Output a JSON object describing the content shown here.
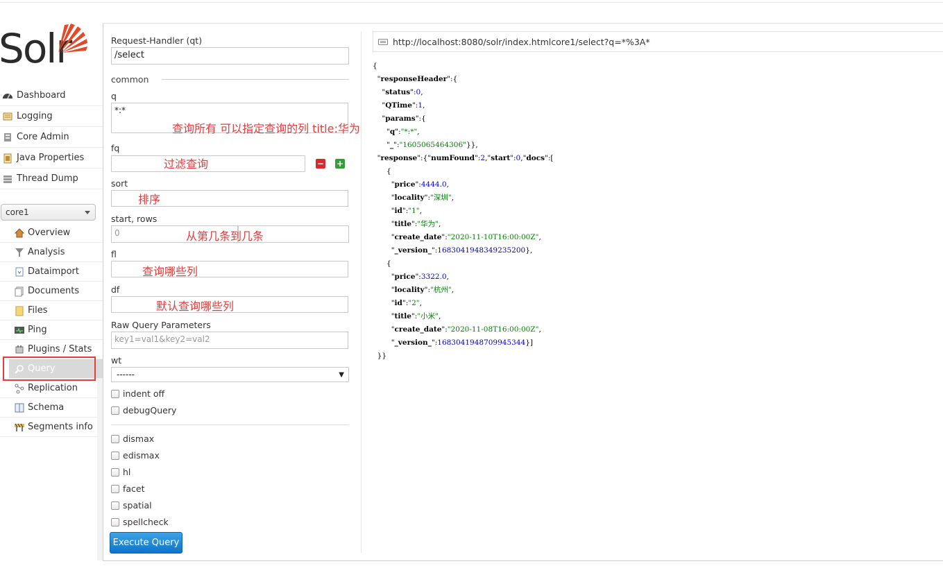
{
  "logo": {
    "text": "Solr"
  },
  "nav": {
    "items": [
      {
        "label": "Dashboard",
        "icon": "dashboard-icon"
      },
      {
        "label": "Logging",
        "icon": "logging-icon"
      },
      {
        "label": "Core Admin",
        "icon": "core-admin-icon"
      },
      {
        "label": "Java Properties",
        "icon": "java-properties-icon"
      },
      {
        "label": "Thread Dump",
        "icon": "thread-dump-icon"
      }
    ]
  },
  "core_selector": {
    "value": "core1"
  },
  "core_nav": {
    "items": [
      {
        "label": "Overview"
      },
      {
        "label": "Analysis"
      },
      {
        "label": "Dataimport"
      },
      {
        "label": "Documents"
      },
      {
        "label": "Files"
      },
      {
        "label": "Ping"
      },
      {
        "label": "Plugins / Stats"
      },
      {
        "label": "Query"
      },
      {
        "label": "Replication"
      },
      {
        "label": "Schema"
      },
      {
        "label": "Segments info"
      }
    ]
  },
  "form": {
    "request_handler_label": "Request-Handler (qt)",
    "request_handler_value": "/select",
    "common_legend": "common",
    "q_label": "q",
    "q_value": "*:*",
    "q_annotation": "查询所有 可以指定查询的列  title:华为",
    "fq_label": "fq",
    "fq_annotation": "过滤查询",
    "sort_label": "sort",
    "sort_annotation": "排序",
    "start_rows_label": "start, rows",
    "start_placeholder": "0",
    "start_rows_annotation": "从第几条到几条",
    "fl_label": "fl",
    "fl_annotation": "查询哪些列",
    "df_label": "df",
    "df_annotation": "默认查询哪些列",
    "raw_label": "Raw Query Parameters",
    "raw_placeholder": "key1=val1&key2=val2",
    "wt_label": "wt",
    "wt_value": "------",
    "indent_label": "indent off",
    "debug_label": "debugQuery",
    "options": [
      "dismax",
      "edismax",
      "hl",
      "facet",
      "spatial",
      "spellcheck"
    ],
    "execute_label": "Execute Query"
  },
  "response": {
    "url": "http://localhost:8080/solr/index.htmlcore1/select?q=*%3A*",
    "status": "0",
    "qtime": "1",
    "param_q": "\"*:*\"",
    "param_underscore": "\"1605065464306\"",
    "numFound": "2",
    "start": "0",
    "docs": [
      {
        "price": "4444.0",
        "locality": "\"深圳\"",
        "id": "\"1\"",
        "title": "\"华为\"",
        "create_date": "\"2020-11-10T16:00:00Z\"",
        "version": "1683041948349235200"
      },
      {
        "price": "3322.0",
        "locality": "\"杭州\"",
        "id": "\"2\"",
        "title": "\"小米\"",
        "create_date": "\"2020-11-08T16:00:00Z\"",
        "version": "1683041948709945344"
      }
    ]
  },
  "colors": {
    "annotation": "#e53b3b",
    "primary_button": "#1a7fd3",
    "json_string": "#008000",
    "json_number": "#0000cc"
  }
}
